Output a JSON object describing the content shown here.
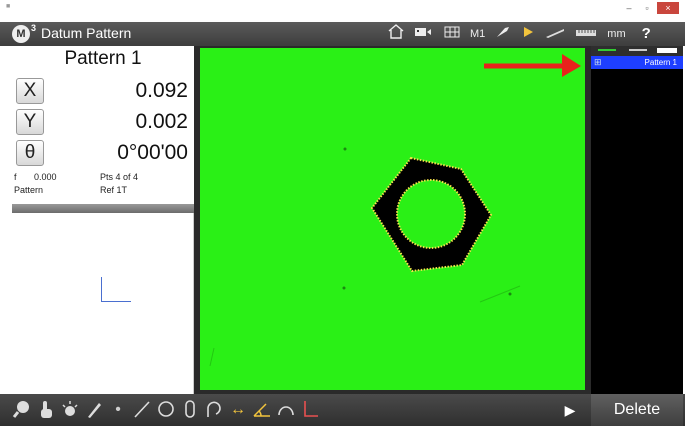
{
  "window": {
    "minimize_label": "–",
    "maximize_label": "▫",
    "close_label": "×"
  },
  "app": {
    "logo": "M",
    "logo_superscript": "3",
    "title": "Datum Pattern",
    "units": "mm",
    "probe_label": "M1",
    "help_label": "?"
  },
  "toolbar_icons": [
    "home-icon",
    "video-camera-icon",
    "grid-icon",
    "probe-icon",
    "play-arrow-icon",
    "stylus-icon",
    "ruler-icon"
  ],
  "dro": {
    "pattern_name": "Pattern 1",
    "rows": [
      {
        "axis": "X",
        "value": "0.092"
      },
      {
        "axis": "Y",
        "value": "0.002"
      },
      {
        "axis": "θ",
        "value": "0°00'00"
      }
    ],
    "info": {
      "f_label": "f",
      "f_value": "0.000",
      "points": "Pts 4 of 4",
      "type_label": "Pattern",
      "ref": "Ref 1T"
    }
  },
  "features_list": {
    "items": [
      {
        "label": "Pattern 1",
        "icon": "pattern-grid-icon",
        "selected": true
      }
    ]
  },
  "bottom_tools": [
    "zoom-icon",
    "touch-hand-icon",
    "light-icon",
    "pen-icon",
    "point-icon",
    "line-icon",
    "circle-icon",
    "slot-icon",
    "arc-icon",
    "distance-icon",
    "angle-icon",
    "curve-icon",
    "datum-icon"
  ],
  "actions": {
    "delete_label": "Delete"
  },
  "colors": {
    "viewport_bg": "#2af016",
    "selected_item": "#1e3fff",
    "highlight_arrow": "#e8221b",
    "edge_points": "#f7e34a"
  }
}
